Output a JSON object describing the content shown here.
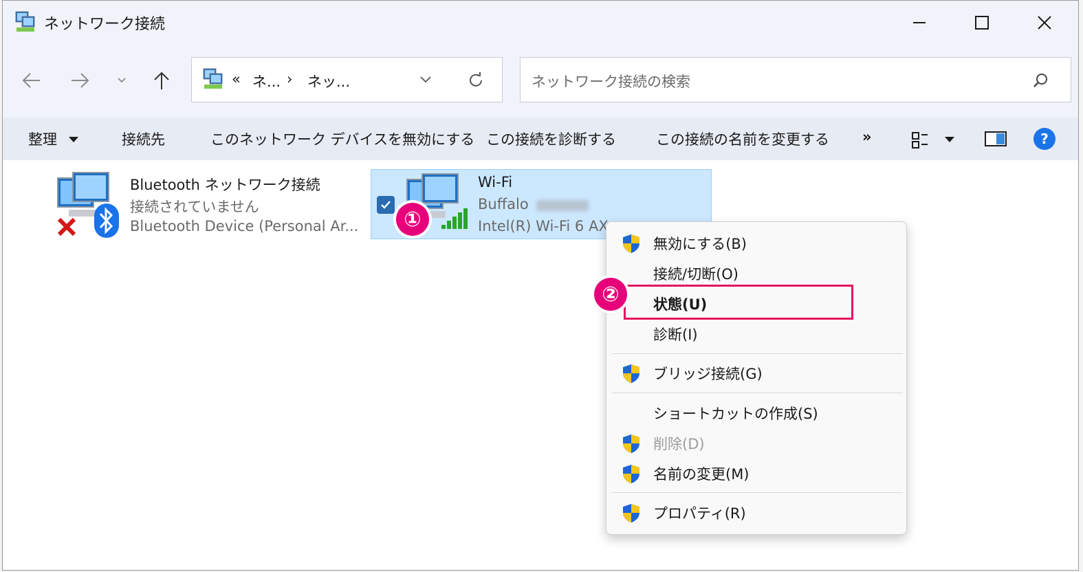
{
  "window": {
    "title": "ネットワーク接続",
    "minimize_icon": "minimize-icon",
    "maximize_icon": "maximize-icon",
    "close_icon": "close-icon"
  },
  "address": {
    "prefix": "«",
    "segment1": "ネ...",
    "separator": "›",
    "segment2": "ネッ...",
    "search_placeholder": "ネットワーク接続の検索"
  },
  "commands": {
    "organize": "整理",
    "connect_to": "接続先",
    "disable_device": "このネットワーク デバイスを無効にする",
    "diagnose": "この接続を診断する",
    "rename": "この接続の名前を変更する",
    "more": "»"
  },
  "items": [
    {
      "name": "Bluetooth ネットワーク接続",
      "status": "接続されていません",
      "device": "Bluetooth Device (Personal Ar..."
    },
    {
      "name": "Wi-Fi",
      "status": "Buffalo",
      "device": "Intel(R) Wi-Fi 6 AX"
    }
  ],
  "context_menu": {
    "disable": "無効にする(B)",
    "connect_disconnect": "接続/切断(O)",
    "status": "状態(U)",
    "diagnose": "診断(I)",
    "bridge": "ブリッジ接続(G)",
    "create_shortcut": "ショートカットの作成(S)",
    "delete": "削除(D)",
    "rename": "名前の変更(M)",
    "properties": "プロパティ(R)"
  },
  "annotations": {
    "step1": "①",
    "step2": "②"
  },
  "colors": {
    "selection_bg": "#cce8ff",
    "highlight_box": "#e6145f",
    "badge": "#e6007a",
    "help_icon": "#1a73e8"
  }
}
